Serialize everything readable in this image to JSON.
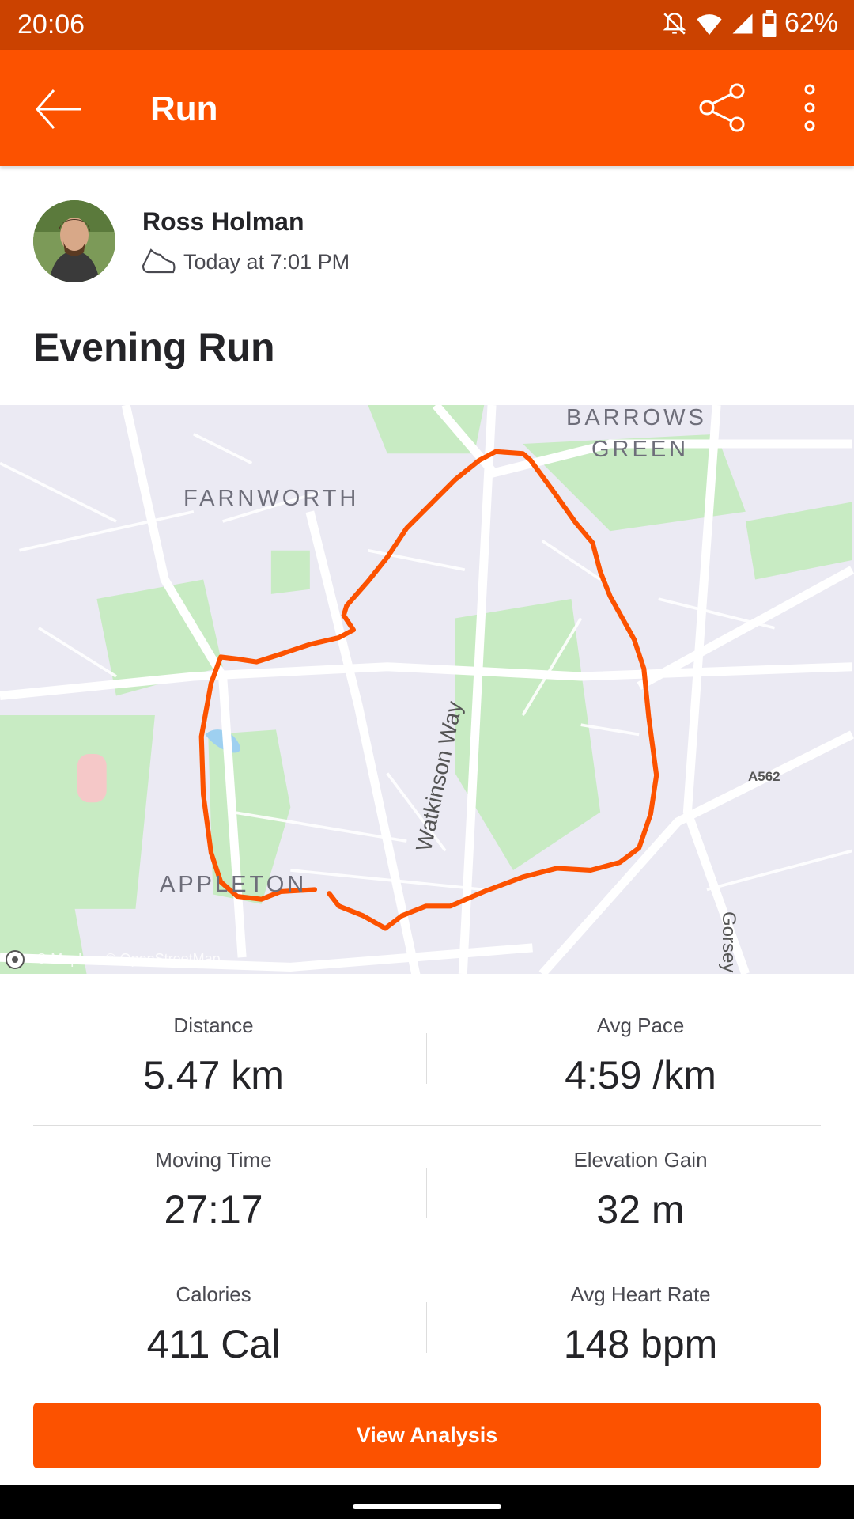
{
  "status_bar": {
    "time": "20:06",
    "battery": "62%"
  },
  "toolbar": {
    "title": "Run"
  },
  "activity": {
    "athlete": "Ross Holman",
    "date": "Today at 7:01 PM",
    "title": "Evening Run"
  },
  "map": {
    "labels": [
      "FARNWORTH",
      "BARROWS",
      "GREEN",
      "APPLETON",
      "A562",
      "Watkinson Way",
      "Gorsey"
    ],
    "attribution": "© Mapbox © OpenStreetMap",
    "route_color": "#fc5200"
  },
  "stats": [
    {
      "label": "Distance",
      "value": "5.47 km"
    },
    {
      "label": "Avg Pace",
      "value": "4:59 /km"
    },
    {
      "label": "Moving Time",
      "value": "27:17"
    },
    {
      "label": "Elevation Gain",
      "value": "32 m"
    },
    {
      "label": "Calories",
      "value": "411 Cal"
    },
    {
      "label": "Avg Heart Rate",
      "value": "148 bpm"
    }
  ],
  "button": {
    "label": "View Analysis"
  },
  "colors": {
    "brand": "#fc5200",
    "status": "#cb4200"
  }
}
